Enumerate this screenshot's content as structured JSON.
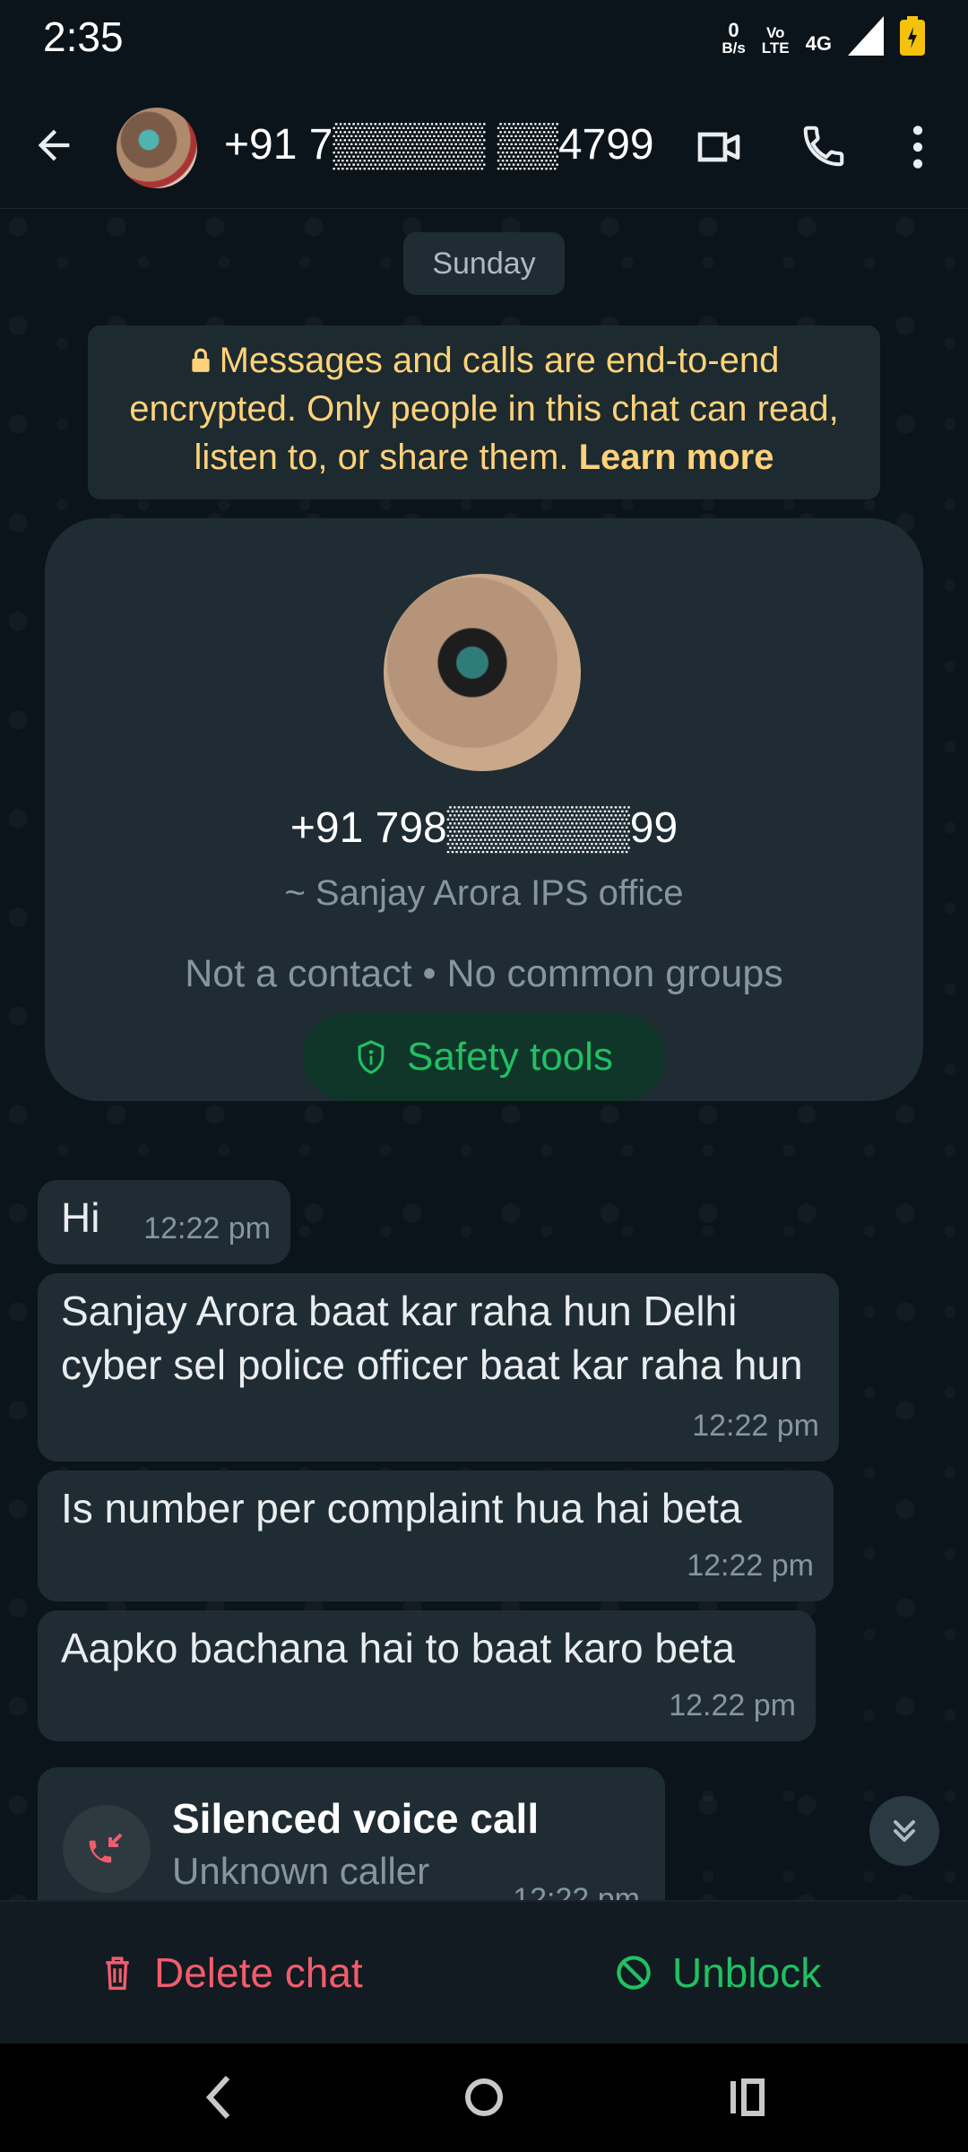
{
  "status_bar": {
    "time": "2:35",
    "net_speed_value": "0",
    "net_speed_unit": "B/s",
    "volte_top": "Vo",
    "volte_bottom": "LTE",
    "network": "4G"
  },
  "header": {
    "contact_title": "+91 7▒▒▒▒▒ ▒▒4799"
  },
  "chat": {
    "day_label": "Sunday",
    "encryption_notice": "Messages and calls are end-to-end encrypted. Only people in this chat can read, listen to, or share them.",
    "learn_more": "Learn more",
    "profile": {
      "phone": "+91 798▒▒▒▒▒▒99",
      "push_name": "~ Sanjay Arora IPS office",
      "contact_info": "Not a contact • No common groups",
      "safety_tools": "Safety tools"
    },
    "messages": [
      {
        "text": "Hi",
        "time": "12:22 pm"
      },
      {
        "text": "Sanjay Arora baat kar raha hun Delhi cyber sel police officer baat kar raha hun",
        "time": "12:22 pm"
      },
      {
        "text": "Is number per complaint hua hai beta",
        "time": "12:22 pm"
      },
      {
        "text": "Aapko bachana hai to baat karo beta",
        "time": "12.22 pm"
      }
    ],
    "call": {
      "title": "Silenced voice call",
      "subtitle": "Unknown caller",
      "time": "12:22 pm"
    }
  },
  "actions": {
    "delete_chat": "Delete chat",
    "unblock": "Unblock"
  },
  "colors": {
    "background": "#0b141a",
    "bubble": "#1f2c33",
    "accent_green": "#21c063",
    "danger_red": "#f15c6d",
    "notice_yellow": "#ffd279"
  },
  "icons": [
    "arrow-left-icon",
    "video-call-icon",
    "phone-icon",
    "more-vert-icon",
    "lock-icon",
    "shield-icon",
    "missed-call-icon",
    "double-chevron-down-icon",
    "trash-icon",
    "block-icon",
    "nav-back-icon",
    "nav-home-icon",
    "nav-recents-icon"
  ]
}
